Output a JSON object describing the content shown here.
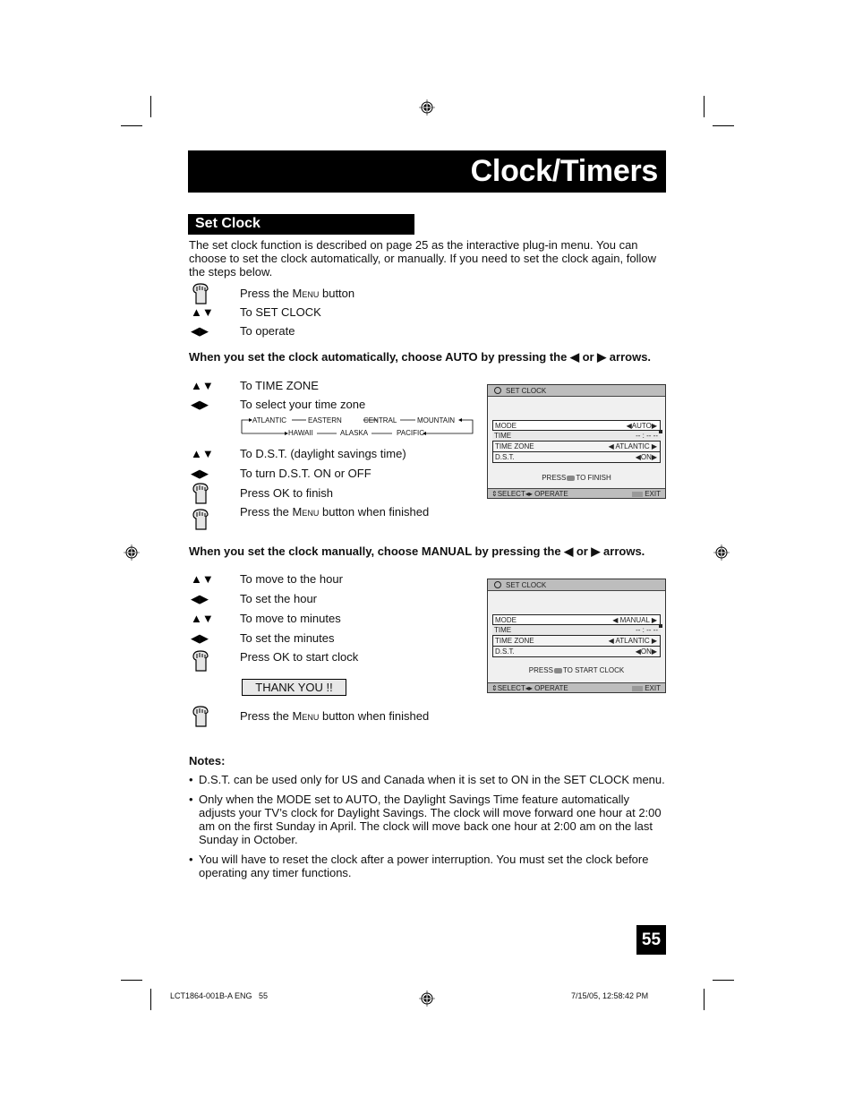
{
  "header": {
    "title": "Clock/Timers"
  },
  "section": {
    "title": "Set Clock"
  },
  "intro": "The set clock function is described on page 25 as the interactive plug-in menu. You can choose to set the clock automatically, or manually. If you need to set the clock again, follow the steps below.",
  "steps_initial": [
    {
      "icon": "hand-press-icon",
      "text_pre": "Press the ",
      "text_sc": "Menu",
      "text_post": " button"
    },
    {
      "icon": "up-down-arrows-icon",
      "glyph": "▲▼",
      "text": "To SET CLOCK"
    },
    {
      "icon": "left-right-arrows-icon",
      "glyph": "◀▶",
      "text": "To operate"
    }
  ],
  "auto_heading": "When you set the clock automatically, choose AUTO by pressing the ◀ or ▶ arrows.",
  "steps_auto": [
    {
      "icon": "up-down-arrows-icon",
      "glyph": "▲▼",
      "text": "To TIME ZONE"
    },
    {
      "icon": "left-right-arrows-icon",
      "glyph": "◀▶",
      "text": "To select your time zone"
    },
    {
      "icon": "up-down-arrows-icon",
      "glyph": "▲▼",
      "text": "To D.S.T. (daylight savings time)"
    },
    {
      "icon": "left-right-arrows-icon",
      "glyph": "◀▶",
      "text": "To turn D.S.T. ON or OFF"
    },
    {
      "icon": "hand-press-icon",
      "text": "Press OK to finish"
    },
    {
      "icon": "hand-press-icon",
      "text_pre": "Press the ",
      "text_sc": "Menu",
      "text_post": " button when finished"
    }
  ],
  "time_zones": {
    "top_row": [
      "ATLANTIC",
      "EASTERN",
      "CENTRAL",
      "MOUNTAIN"
    ],
    "bottom_row": [
      "HAWAII",
      "ALASKA",
      "PACIFIC"
    ]
  },
  "osd_auto": {
    "title": "SET CLOCK",
    "rows": [
      {
        "label": "MODE",
        "value": "◀AUTO▶"
      },
      {
        "label": "TIME",
        "value": "-- : -- --"
      },
      {
        "label": "TIME ZONE",
        "value": "◀ ATLANTIC ▶"
      },
      {
        "label": "D.S.T.",
        "value": "◀ON▶"
      }
    ],
    "press_pre": "PRESS",
    "press_post": "TO FINISH",
    "footer_left": "⇕SELECT◂▸ OPERATE",
    "footer_menu": "MENU",
    "footer_right": "EXIT"
  },
  "manual_heading": "When you set the clock manually, choose MANUAL by pressing the ◀ or ▶ arrows.",
  "steps_manual": [
    {
      "icon": "up-down-arrows-icon",
      "glyph": "▲▼",
      "text": "To move to the hour"
    },
    {
      "icon": "left-right-arrows-icon",
      "glyph": "◀▶",
      "text": "To set the hour"
    },
    {
      "icon": "up-down-arrows-icon",
      "glyph": "▲▼",
      "text": "To move to minutes"
    },
    {
      "icon": "left-right-arrows-icon",
      "glyph": "◀▶",
      "text": "To set the minutes"
    },
    {
      "icon": "hand-press-icon",
      "text": "Press OK to start clock"
    }
  ],
  "thank_you": "THANK YOU !!",
  "step_manual_final": {
    "icon": "hand-press-icon",
    "text_pre": "Press the ",
    "text_sc": "Menu",
    "text_post": " button when finished"
  },
  "osd_manual": {
    "title": "SET CLOCK",
    "rows": [
      {
        "label": "MODE",
        "value": "◀ MANUAL ▶"
      },
      {
        "label": "TIME",
        "value": "-- : -- --"
      },
      {
        "label": "TIME ZONE",
        "value": "◀ ATLANTIC ▶"
      },
      {
        "label": "D.S.T.",
        "value": "◀ON▶"
      }
    ],
    "press_pre": "PRESS",
    "press_post": "TO START CLOCK",
    "footer_left": "⇕SELECT◂▸ OPERATE",
    "footer_menu": "MENU",
    "footer_right": "EXIT"
  },
  "notes": {
    "title": "Notes:",
    "items": [
      "D.S.T. can be used only for US and Canada when it is set to ON in the SET CLOCK menu.",
      "Only when the MODE set to AUTO, the Daylight Savings Time feature automatically adjusts your TV’s clock for Daylight Savings. The clock will move forward one hour at 2:00 am on the first Sunday in April. The clock will move back one hour at 2:00 am on the last Sunday in October.",
      "You will have to reset the clock after a power interruption. You must set the clock before operating any timer functions."
    ]
  },
  "page_number": "55",
  "footer": {
    "left": "LCT1864-001B-A ENG   55",
    "right": "7/15/05, 12:58:42 PM"
  }
}
